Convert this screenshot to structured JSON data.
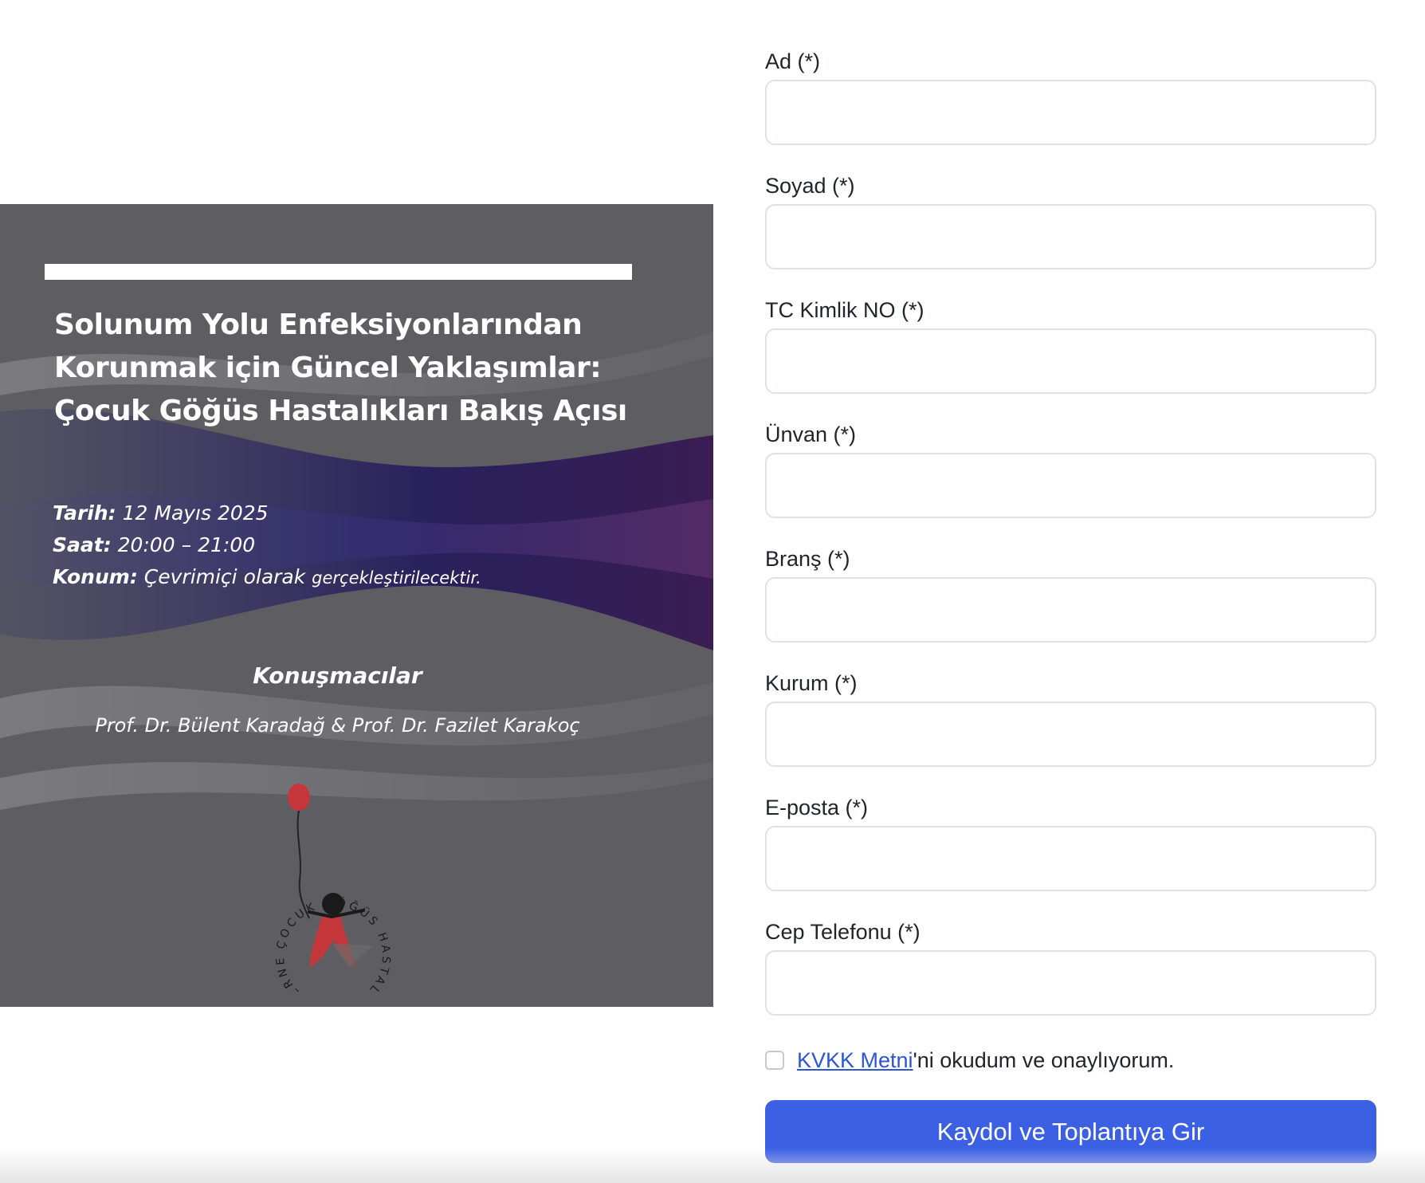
{
  "poster": {
    "title_lines": [
      "Solunum Yolu Enfeksiyonlarından",
      "Korunmak için Güncel Yaklaşımlar:",
      "Çocuk Göğüs Hastalıkları Bakış Açısı"
    ],
    "date_label": "Tarih:",
    "date_value": "12 Mayıs 2025",
    "time_label": "Saat:",
    "time_value": "20:00 – 21:00",
    "location_label": "Konum:",
    "location_value_1": "Çevrimiçi olarak",
    "location_value_2": "gerçekleştirilecektir.",
    "speakers_heading": "Konuşmacılar",
    "speakers": "Prof. Dr. Bülent Karadağ & Prof. Dr. Fazilet Karakoç",
    "logo_text": "ÇOCUK GÖĞÜS HASTALIKLARI DERNEĞİ"
  },
  "form": {
    "fields": [
      {
        "label": "Ad (*)",
        "value": ""
      },
      {
        "label": "Soyad (*)",
        "value": ""
      },
      {
        "label": "TC Kimlik NO (*)",
        "value": ""
      },
      {
        "label": "Ünvan (*)",
        "value": ""
      },
      {
        "label": "Branş (*)",
        "value": ""
      },
      {
        "label": "Kurum (*)",
        "value": ""
      },
      {
        "label": "E-posta (*)",
        "value": ""
      },
      {
        "label": "Cep Telefonu (*)",
        "value": ""
      }
    ],
    "kvkk_link": "KVKK Metni",
    "kvkk_text": "'ni okudum ve onaylıyorum.",
    "kvkk_checked": false,
    "submit_label": "Kaydol ve Toplantıya Gir"
  },
  "colors": {
    "accent": "#3b60e4",
    "link": "#2b56d6",
    "poster_bg": "#5e5d62"
  }
}
